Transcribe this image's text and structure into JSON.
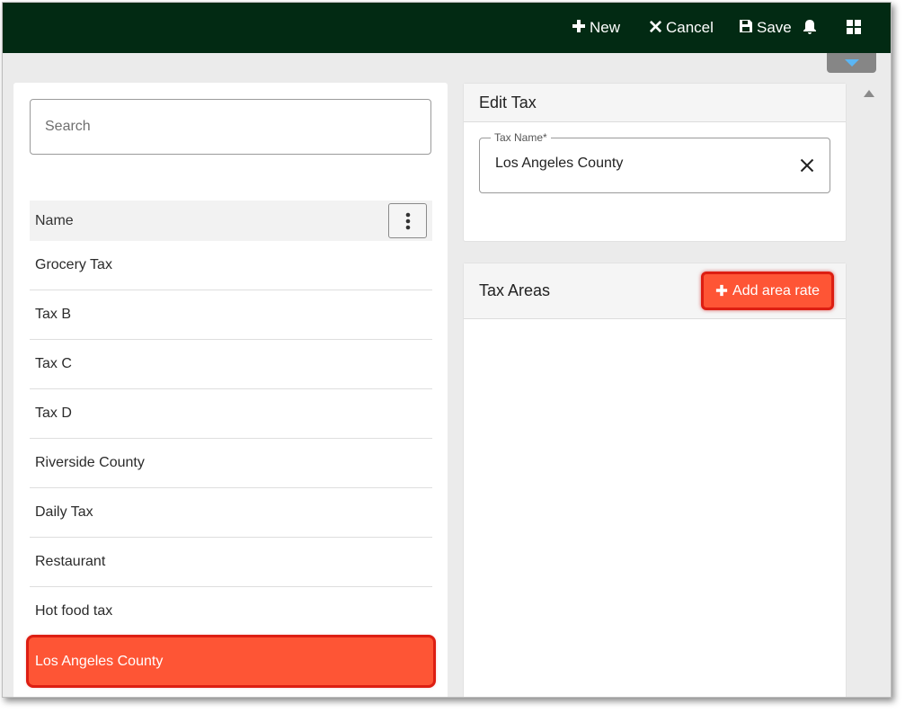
{
  "toolbar": {
    "new_label": "New",
    "cancel_label": "Cancel",
    "save_label": "Save",
    "icons": {
      "new": "plus-icon",
      "cancel": "x-icon",
      "save": "floppy-disk-icon",
      "notifications": "bell-icon",
      "apps": "grid-icon"
    }
  },
  "search": {
    "placeholder": "Search",
    "value": ""
  },
  "list": {
    "header": "Name",
    "items": [
      {
        "label": "Grocery Tax"
      },
      {
        "label": "Tax B"
      },
      {
        "label": "Tax C"
      },
      {
        "label": "Tax D"
      },
      {
        "label": "Riverside County"
      },
      {
        "label": "Daily Tax"
      },
      {
        "label": "Restaurant"
      },
      {
        "label": "Hot food tax"
      },
      {
        "label": "Los Angeles County"
      }
    ],
    "selected_index": 8
  },
  "edit_tax": {
    "title": "Edit Tax",
    "field_label": "Tax Name*",
    "field_value": "Los Angeles County"
  },
  "tax_areas": {
    "title": "Tax Areas",
    "add_label": "Add area rate"
  },
  "colors": {
    "topbar": "#022a13",
    "accent": "#fe5535",
    "highlight_border": "#dd1e12"
  }
}
